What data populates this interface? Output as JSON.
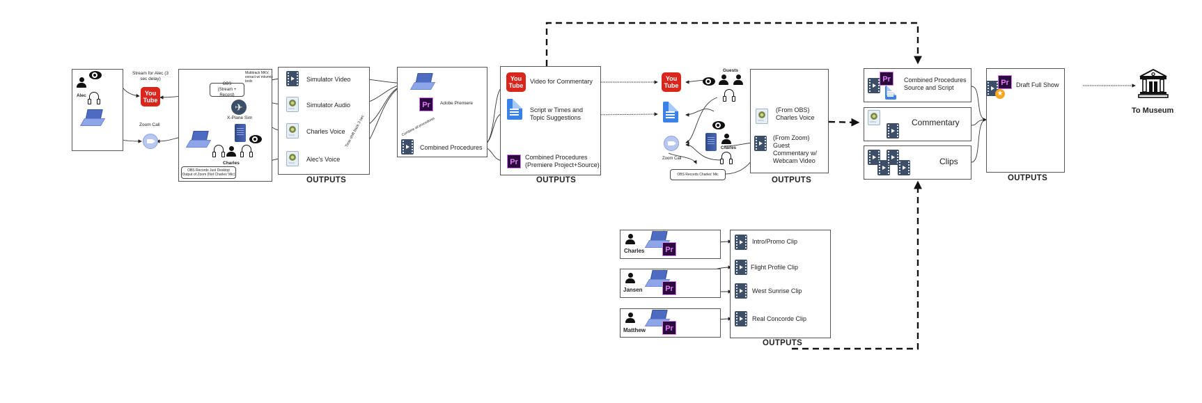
{
  "stage1": {
    "alec_label": "Alec",
    "stream_label": "Stream for Alec (3 sec delay)",
    "youtube_text_top": "You",
    "youtube_text_bottom": "Tube",
    "zoom_call_label": "Zoom Call"
  },
  "stage2": {
    "obs_label": "OBS\n(Stream + Record)",
    "multitrack_note": "Multitrack MKV, extract w/ mkvmix tools",
    "xplane_label": "X-Plane Sim",
    "charles_label": "Charles",
    "obs_records_note": "OBS Records Just Desktop Output of Zoom (Not Charles' Mic)"
  },
  "outputs1": {
    "title": "OUTPUTS",
    "items": [
      {
        "label": "Simulator Video",
        "icon": "video-file-icon"
      },
      {
        "label": "Simulator Audio",
        "icon": "wav-file-icon"
      },
      {
        "label": "Charles Voice",
        "icon": "wav-file-icon"
      },
      {
        "label": "Alec's Voice",
        "icon": "wav-file-icon"
      }
    ],
    "time_shift_note": "Time shift back 3 sec"
  },
  "premiere_stage": {
    "app_label": "Adobe Premiere",
    "combine_note": "Combine all procedures",
    "combined_label": "Combined Procedures"
  },
  "outputs2": {
    "title": "OUTPUTS",
    "items": [
      {
        "label": "Video for Commentary",
        "icon": "youtube-icon"
      },
      {
        "label": "Script w Times and Topic Suggestions",
        "icon": "google-doc-icon"
      },
      {
        "label": "Combined Procedures (Premiere Project+Source)",
        "icon": "premiere-icon"
      }
    ]
  },
  "commentary_stage": {
    "guests_label": "Guests",
    "charles_label": "Charles",
    "zoom_call_label": "Zoom Call",
    "obs_records_note": "OBS Records Charles' Mic"
  },
  "outputs3": {
    "title": "OUTPUTS",
    "items": [
      {
        "label": "(From OBS) Charles Voice",
        "icon": "wav-file-icon"
      },
      {
        "label": "(From Zoom) Guest Commentary w/ Webcam Video",
        "icon": "video-file-icon"
      }
    ]
  },
  "assembly": {
    "items": [
      {
        "label": "Combined Procedures Source and Script"
      },
      {
        "label": "Commentary"
      },
      {
        "label": "Clips"
      }
    ]
  },
  "outputs4": {
    "title": "OUTPUTS",
    "draft_label": "Draft Full Show"
  },
  "destination": {
    "label": "To Museum"
  },
  "clips_stage": {
    "editors": [
      {
        "name": "Charles"
      },
      {
        "name": "Jansen"
      },
      {
        "name": "Matthew"
      }
    ],
    "outputs_title": "OUTPUTS",
    "clips": [
      {
        "label": "Intro/Promo Clip"
      },
      {
        "label": "Flight Profile Clip"
      },
      {
        "label": "West Sunrise Clip"
      },
      {
        "label": "Real Concorde Clip"
      }
    ]
  }
}
